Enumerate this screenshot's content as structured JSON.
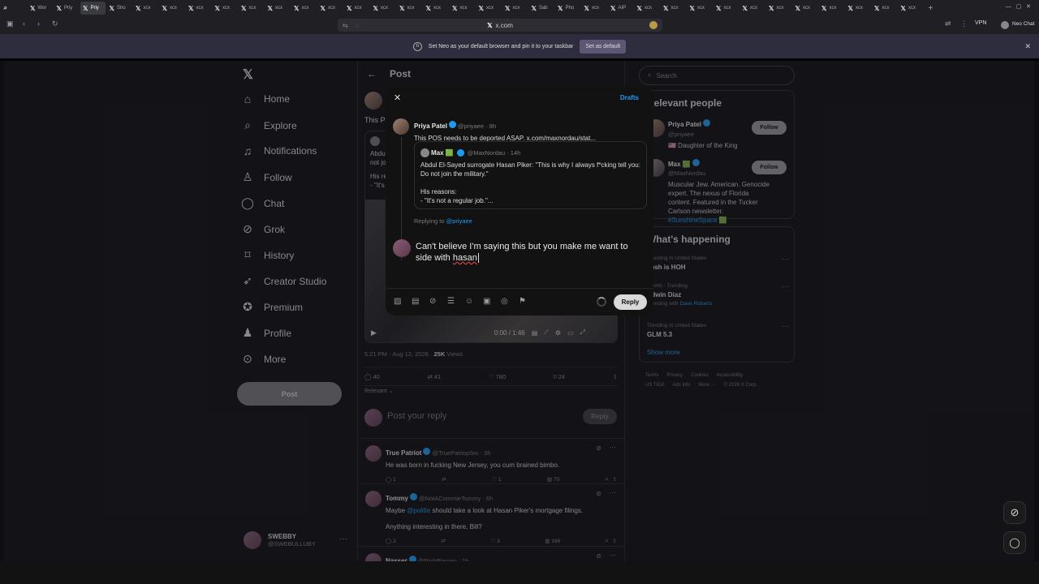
{
  "browser": {
    "tabs": [
      {
        "label": "",
        "icon": "search-icon"
      },
      {
        "label": "Wor"
      },
      {
        "label": "Priy"
      },
      {
        "label": "Priy",
        "active": true
      },
      {
        "label": "Sho"
      },
      {
        "label": "xcx"
      },
      {
        "label": "xcx"
      },
      {
        "label": "xcx"
      },
      {
        "label": "xcx"
      },
      {
        "label": "xcx"
      },
      {
        "label": "xcx"
      },
      {
        "label": "xcx"
      },
      {
        "label": "xcx"
      },
      {
        "label": "xcx"
      },
      {
        "label": "xcx"
      },
      {
        "label": "xcx"
      },
      {
        "label": "xcx"
      },
      {
        "label": "xcx"
      },
      {
        "label": "xcx"
      },
      {
        "label": "xcx"
      },
      {
        "label": "Sab"
      },
      {
        "label": "Pho"
      },
      {
        "label": "xcx"
      },
      {
        "label": "AIP"
      },
      {
        "label": "xcx"
      },
      {
        "label": "xcx"
      },
      {
        "label": "xcx"
      },
      {
        "label": "xcx"
      },
      {
        "label": "xcx"
      },
      {
        "label": "xcx"
      },
      {
        "label": "xcx"
      },
      {
        "label": "xcx"
      },
      {
        "label": "xcx"
      },
      {
        "label": "xcx"
      },
      {
        "label": "xcx"
      }
    ],
    "address": "x.com",
    "vpn_label": "VPN",
    "profile_label": "Neo Chat",
    "banner_text": "Set Neo as your default browser and pin it to your taskbar",
    "banner_button": "Set as default"
  },
  "sidebar": {
    "items": [
      {
        "label": "Home",
        "icon": "home-icon"
      },
      {
        "label": "Explore",
        "icon": "search-icon"
      },
      {
        "label": "Notifications",
        "icon": "bell-icon"
      },
      {
        "label": "Follow",
        "icon": "person-add-icon"
      },
      {
        "label": "Chat",
        "icon": "chat-icon"
      },
      {
        "label": "Grok",
        "icon": "grok-icon"
      },
      {
        "label": "History",
        "icon": "bookmark-icon"
      },
      {
        "label": "Creator Studio",
        "icon": "rocket-icon"
      },
      {
        "label": "Premium",
        "icon": "verified-icon"
      },
      {
        "label": "Profile",
        "icon": "person-icon"
      },
      {
        "label": "More",
        "icon": "more-circle-icon"
      }
    ],
    "post_button": "Post",
    "user_name": "SWEBBY",
    "user_handle": "@SWEBULLUBY"
  },
  "post": {
    "header_title": "Post",
    "text_start": "This P",
    "quote_preview_line1": "Abdu",
    "quote_preview_line2": "not jo",
    "quote_preview_line3": "His re",
    "quote_preview_line4": "- \"It's",
    "video_time": "0:00 / 1:46",
    "timestamp": "5:21 PM · Aug 13, 2026 ·",
    "views_count": "25K",
    "views_label": "Views",
    "stats": {
      "replies": "40",
      "reposts": "41",
      "likes": "780",
      "bookmarks": "24"
    },
    "sort_label": "Relevant",
    "reply_placeholder": "Post your reply",
    "reply_button": "Reply"
  },
  "replies": [
    {
      "name": "True Patriot",
      "handle": "@TruePatriop5m · 3h",
      "text": "He was born in fucking New Jersey, you cum brained bimbo.",
      "replies": "1",
      "reposts": "",
      "likes": "1",
      "views": "70"
    },
    {
      "name": "Tommy",
      "handle": "@NotACommieTommy · 6h",
      "text_pre": "Maybe",
      "mention": "@politie",
      "text_post": "should take a look at Hasan Piker's mortgage filings.",
      "text2": "Anything interesting in there, Bill?",
      "replies": "2",
      "reposts": "",
      "likes": "3",
      "views": "166"
    },
    {
      "name": "Nasser",
      "handle": "@RichPlanian · 1h"
    }
  ],
  "right": {
    "search_placeholder": "Search",
    "relevant_title": "Relevant people",
    "people": [
      {
        "name": "Priya Patel",
        "handle": "@priyaee",
        "bio": "🇺🇸 Daughter of the King",
        "follow": "Follow"
      },
      {
        "name": "Max 🟩",
        "handle": "@MaxNordau",
        "bio_pre": "Muscular Jew. American. Genocide expert. The nexus of Florida content. Featured in the Tucker Carlson newsletter.",
        "bio_tag": "#SunshineSpace",
        "bio_emoji": "🟩",
        "follow": "Follow"
      }
    ],
    "happening_title": "What's happening",
    "trends": [
      {
        "context": "Trending in United States",
        "topic": "Josh is HOH"
      },
      {
        "context": "Sports · Trending",
        "topic": "Edwin Diaz",
        "with_pre": "Trending with",
        "with_link": "Dave Roberts"
      },
      {
        "context": "Trending in United States",
        "topic": "GLM 5.3"
      }
    ],
    "show_more": "Show more",
    "footer_line1": [
      "Terms",
      "Privacy",
      "Cookies",
      "Accessibility"
    ],
    "footer_line2": [
      "US TIDA",
      "Ads info",
      "More ···",
      "© 2026 X Corp."
    ]
  },
  "modal": {
    "drafts": "Drafts",
    "orig_name": "Priya Patel",
    "orig_handle": "@priyaee · 8h",
    "orig_text": "This POS needs to be deported ASAP. x.com/maxnordau/stat...",
    "quote_name": "Max 🟩",
    "quote_handle": "@MaxNordau · 14h",
    "quote_text1": "Abdul El-Sayed surrogate Hasan Piker: \"This is why I always f*cking tell you: Do not join the military.\"",
    "quote_text2": "His reasons:",
    "quote_text3": "- \"It's not a regular job.\"...",
    "replying_to_label": "Replying to",
    "replying_to_handle": "@priyaee",
    "draft_text_pre": "Can't believe I'm saying this but you make me want to side with ",
    "draft_text_word": "hasan",
    "reply_button": "Reply"
  }
}
